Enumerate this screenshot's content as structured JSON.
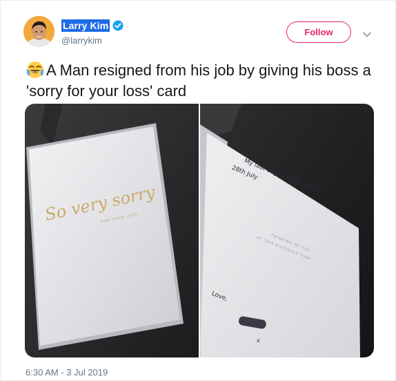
{
  "tweet": {
    "author_name": "Larry Kim",
    "author_handle": "@larrykim",
    "verified": true,
    "follow_label": "Follow",
    "text": "A Man resigned from his job by giving his boss a 'sorry for your loss' card",
    "emoji": "face-with-tears-of-joy",
    "timestamp": "6:30 AM - 3 Jul 2019"
  },
  "media": {
    "left_card": {
      "script": "So very sorry",
      "subtitle": "FOR YOUR LOSS"
    },
    "right_card": {
      "handwriting_line1": "My last day at work is the",
      "handwriting_line2": "28th July",
      "printed_line1": "THINKING OF YOU",
      "printed_line2": "AT THIS DIFFICULT TIME",
      "sign_off": "Love,",
      "kiss": "x"
    }
  },
  "colors": {
    "accent": "#e8245b",
    "verified": "#1da1f2",
    "name_highlight": "#1e6ce6",
    "muted": "#657786",
    "text": "#14171a"
  }
}
